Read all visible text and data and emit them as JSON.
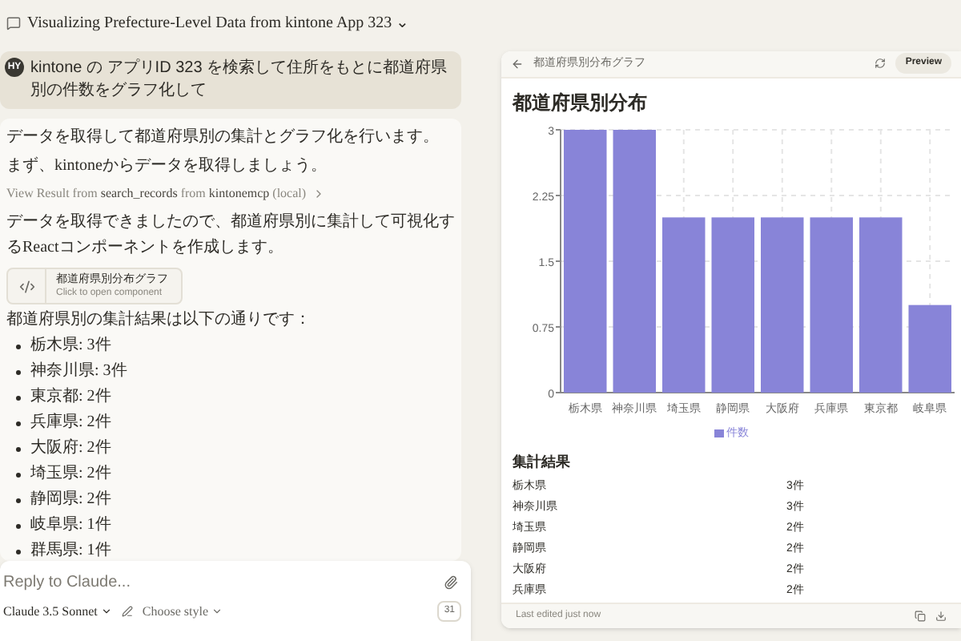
{
  "header": {
    "title": "Visualizing Prefecture-Level Data from kintone App 323 ⌄"
  },
  "user_message": {
    "avatar": "HY",
    "text": "kintone の アプリID 323 を検索して住所をもとに都道府県別の件数をグラフ化して"
  },
  "assistant_message": {
    "paragraphs": [
      "データを取得して都道府県別の集計とグラフ化を行います。",
      "まず、kintoneからデータを取得しましょう。"
    ],
    "tool_result": {
      "prefix": "View Result from",
      "tool": "search_records",
      "middle": "from",
      "server": "kintonemcp",
      "suffix": "(local)"
    },
    "paragraph_after": "データを取得できましたので、都道府県別に集計して可視化するReactコンポーネントを作成します。",
    "artifact": {
      "title": "都道府県別分布グラフ",
      "subtitle": "Click to open component"
    },
    "summary": "都道府県別の集計結果は以下の通りです：",
    "items": [
      "栃木県: 3件",
      "神奈川県: 3件",
      "東京都: 2件",
      "兵庫県: 2件",
      "大阪府: 2件",
      "埼玉県: 2件",
      "静岡県: 2件",
      "岐阜県: 1件",
      "群馬県: 1件"
    ]
  },
  "composer": {
    "placeholder": "Reply to Claude...",
    "model": "Claude 3.5 Sonnet",
    "style": "Choose style",
    "badge": "31"
  },
  "artifact_panel": {
    "title": "都道府県別分布グラフ",
    "preview_button": "Preview",
    "heading": "都道府県別分布",
    "chart_data": {
      "type": "bar",
      "categories": [
        "栃木県",
        "神奈川県",
        "埼玉県",
        "静岡県",
        "大阪府",
        "兵庫県",
        "東京都",
        "岐阜県"
      ],
      "series": [
        {
          "name": "件数",
          "color": "#8884d8",
          "values": [
            3,
            3,
            2,
            2,
            2,
            2,
            2,
            1
          ]
        }
      ],
      "ylim": [
        0,
        3
      ],
      "grid": true,
      "yticks": [
        0,
        0.75,
        1.5,
        2.25,
        3
      ]
    },
    "table_title": "集計結果",
    "rows": [
      {
        "name": "栃木県",
        "count": "3件"
      },
      {
        "name": "神奈川県",
        "count": "3件"
      },
      {
        "name": "埼玉県",
        "count": "2件"
      },
      {
        "name": "静岡県",
        "count": "2件"
      },
      {
        "name": "大阪府",
        "count": "2件"
      },
      {
        "name": "兵庫県",
        "count": "2件"
      }
    ],
    "footer": "Last edited just now"
  }
}
